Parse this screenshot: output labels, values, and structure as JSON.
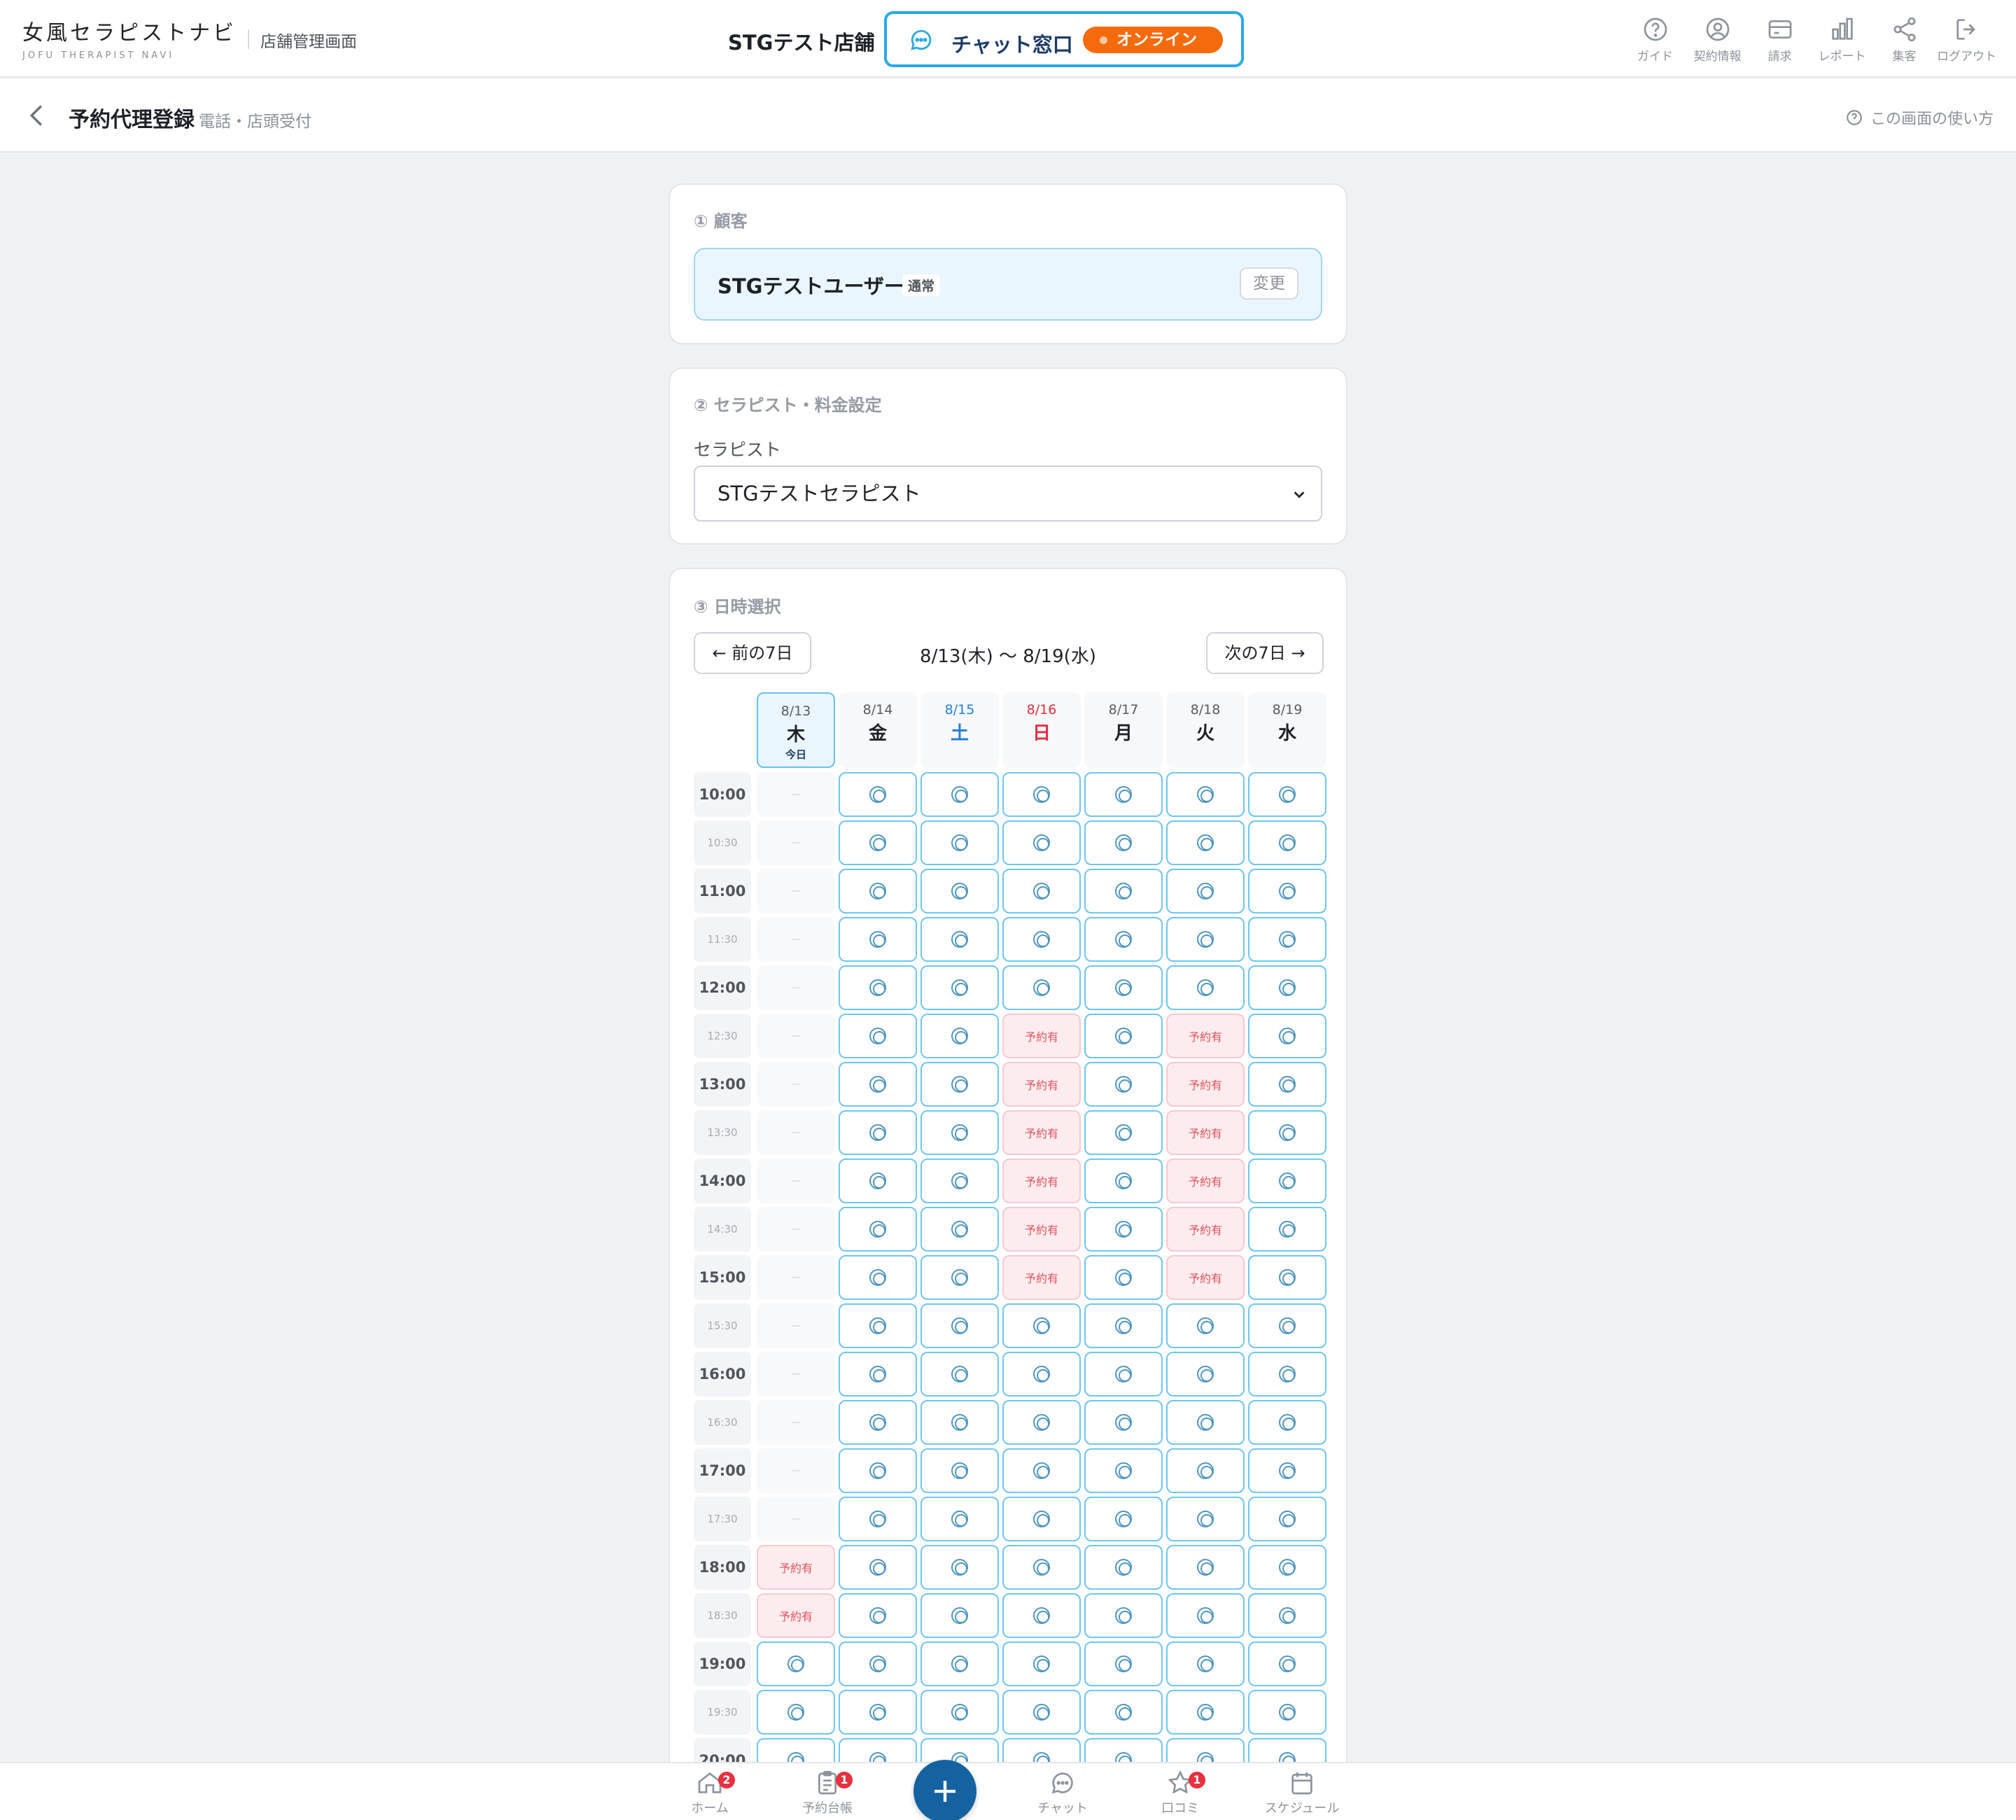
{
  "header": {
    "logo_main": "女風セラピストナビ",
    "logo_sub": "JOFU THERAPIST NAVI",
    "admin_label": "店舗管理画面",
    "store_name": "STGテスト店舗",
    "chat_label": "チャット窓口",
    "online_label": "オンライン",
    "nav": [
      {
        "icon": "help-circle-icon",
        "label": "ガイド"
      },
      {
        "icon": "user-circle-icon",
        "label": "契約情報"
      },
      {
        "icon": "credit-card-icon",
        "label": "請求"
      },
      {
        "icon": "bar-chart-icon",
        "label": "レポート"
      },
      {
        "icon": "share-icon",
        "label": "集客"
      },
      {
        "icon": "logout-icon",
        "label": "ログアウト"
      }
    ]
  },
  "page": {
    "title": "予約代理登録",
    "subtitle": "電話・店頭受付",
    "help": "この画面の使い方"
  },
  "customer": {
    "section_title": "① 顧客",
    "name": "STGテストユーザー",
    "badge": "通常",
    "change": "変更"
  },
  "therapist": {
    "section_title": "② セラピスト・料金設定",
    "label": "セラピスト",
    "selected": "STGテストセラピスト"
  },
  "schedule": {
    "section_title": "③ 日時選択",
    "prev": "← 前の7日",
    "next": "次の7日 →",
    "range": "8/13(木) 〜 8/19(水)",
    "today_label": "今日",
    "available_symbol": "◎",
    "booked_label": "予約有",
    "na_label": "—",
    "days": [
      {
        "date": "8/13",
        "weekday": "木",
        "today": true,
        "color": "#1e2228"
      },
      {
        "date": "8/14",
        "weekday": "金",
        "today": false,
        "color": "#1e2228"
      },
      {
        "date": "8/15",
        "weekday": "土",
        "today": false,
        "color": "#1f7ed6"
      },
      {
        "date": "8/16",
        "weekday": "日",
        "today": false,
        "color": "#e0303e"
      },
      {
        "date": "8/17",
        "weekday": "月",
        "today": false,
        "color": "#1e2228"
      },
      {
        "date": "8/18",
        "weekday": "火",
        "today": false,
        "color": "#1e2228"
      },
      {
        "date": "8/19",
        "weekday": "水",
        "today": false,
        "color": "#1e2228"
      }
    ],
    "slots": [
      {
        "time": "10:00",
        "cells": [
          "na",
          "av",
          "av",
          "av",
          "av",
          "av",
          "av"
        ]
      },
      {
        "time": "10:30",
        "cells": [
          "na",
          "av",
          "av",
          "av",
          "av",
          "av",
          "av"
        ]
      },
      {
        "time": "11:00",
        "cells": [
          "na",
          "av",
          "av",
          "av",
          "av",
          "av",
          "av"
        ]
      },
      {
        "time": "11:30",
        "cells": [
          "na",
          "av",
          "av",
          "av",
          "av",
          "av",
          "av"
        ]
      },
      {
        "time": "12:00",
        "cells": [
          "na",
          "av",
          "av",
          "av",
          "av",
          "av",
          "av"
        ]
      },
      {
        "time": "12:30",
        "cells": [
          "na",
          "av",
          "av",
          "bk",
          "av",
          "bk",
          "av"
        ]
      },
      {
        "time": "13:00",
        "cells": [
          "na",
          "av",
          "av",
          "bk",
          "av",
          "bk",
          "av"
        ]
      },
      {
        "time": "13:30",
        "cells": [
          "na",
          "av",
          "av",
          "bk",
          "av",
          "bk",
          "av"
        ]
      },
      {
        "time": "14:00",
        "cells": [
          "na",
          "av",
          "av",
          "bk",
          "av",
          "bk",
          "av"
        ]
      },
      {
        "time": "14:30",
        "cells": [
          "na",
          "av",
          "av",
          "bk",
          "av",
          "bk",
          "av"
        ]
      },
      {
        "time": "15:00",
        "cells": [
          "na",
          "av",
          "av",
          "bk",
          "av",
          "bk",
          "av"
        ]
      },
      {
        "time": "15:30",
        "cells": [
          "na",
          "av",
          "av",
          "av",
          "av",
          "av",
          "av"
        ]
      },
      {
        "time": "16:00",
        "cells": [
          "na",
          "av",
          "av",
          "av",
          "av",
          "av",
          "av"
        ]
      },
      {
        "time": "16:30",
        "cells": [
          "na",
          "av",
          "av",
          "av",
          "av",
          "av",
          "av"
        ]
      },
      {
        "time": "17:00",
        "cells": [
          "na",
          "av",
          "av",
          "av",
          "av",
          "av",
          "av"
        ]
      },
      {
        "time": "17:30",
        "cells": [
          "na",
          "av",
          "av",
          "av",
          "av",
          "av",
          "av"
        ]
      },
      {
        "time": "18:00",
        "cells": [
          "bk",
          "av",
          "av",
          "av",
          "av",
          "av",
          "av"
        ]
      },
      {
        "time": "18:30",
        "cells": [
          "bk",
          "av",
          "av",
          "av",
          "av",
          "av",
          "av"
        ]
      },
      {
        "time": "19:00",
        "cells": [
          "av",
          "av",
          "av",
          "av",
          "av",
          "av",
          "av"
        ]
      },
      {
        "time": "19:30",
        "cells": [
          "av",
          "av",
          "av",
          "av",
          "av",
          "av",
          "av"
        ]
      },
      {
        "time": "20:00",
        "cells": [
          "av",
          "av",
          "av",
          "av",
          "av",
          "av",
          "av"
        ]
      }
    ]
  },
  "bottom_nav": [
    {
      "icon": "home-icon",
      "label": "ホーム",
      "badge": "2"
    },
    {
      "icon": "clipboard-icon",
      "label": "予約台帳",
      "badge": "1"
    },
    {
      "icon": "chat-bubble-icon",
      "label": "チャット",
      "badge": ""
    },
    {
      "icon": "star-icon",
      "label": "口コミ",
      "badge": "1"
    },
    {
      "icon": "calendar-icon",
      "label": "スケジュール",
      "badge": ""
    }
  ],
  "colors": {
    "accent": "#29a9e6",
    "online": "#f46b0d",
    "booked": "#e0525f",
    "fab": "#1463a0",
    "badge": "#e8303f"
  }
}
